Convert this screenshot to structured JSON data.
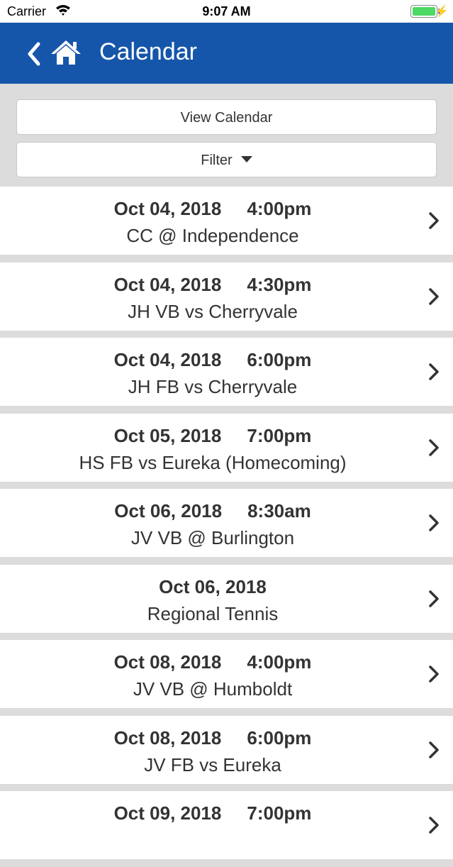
{
  "status": {
    "carrier": "Carrier",
    "time": "9:07 AM"
  },
  "nav": {
    "title": "Calendar"
  },
  "controls": {
    "view_calendar": "View Calendar",
    "filter": "Filter"
  },
  "events": [
    {
      "date": "Oct 04, 2018",
      "time": "4:00pm",
      "title": "CC @ Independence"
    },
    {
      "date": "Oct 04, 2018",
      "time": "4:30pm",
      "title": "JH VB vs Cherryvale"
    },
    {
      "date": "Oct 04, 2018",
      "time": "6:00pm",
      "title": "JH FB vs Cherryvale"
    },
    {
      "date": "Oct 05, 2018",
      "time": "7:00pm",
      "title": "HS FB vs Eureka (Homecoming)"
    },
    {
      "date": "Oct 06, 2018",
      "time": "8:30am",
      "title": "JV VB @ Burlington"
    },
    {
      "date": "Oct 06, 2018",
      "time": "",
      "title": "Regional Tennis"
    },
    {
      "date": "Oct 08, 2018",
      "time": "4:00pm",
      "title": "JV VB @ Humboldt"
    },
    {
      "date": "Oct 08, 2018",
      "time": "6:00pm",
      "title": "JV FB vs Eureka"
    },
    {
      "date": "Oct 09, 2018",
      "time": "7:00pm",
      "title": ""
    }
  ],
  "icons": {
    "back": "chevron-left-icon",
    "home": "home-icon",
    "row": "chevron-right-icon"
  },
  "colors": {
    "nav": "#1556aa",
    "background": "#dcdcdc",
    "battery": "#4cd964"
  }
}
